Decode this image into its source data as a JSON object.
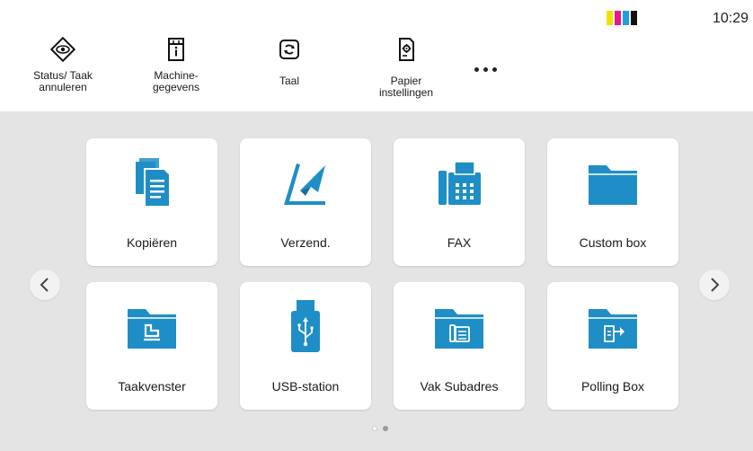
{
  "status_bar": {
    "time": "10:29",
    "toner_colors": [
      "#f2e200",
      "#e8178a",
      "#1ea0dc",
      "#111111"
    ]
  },
  "quick_access": [
    {
      "label_line1": "Status/ Taak",
      "label_line2": "annuleren",
      "icon": "status-eye-icon"
    },
    {
      "label_line1": "Machine-",
      "label_line2": "gegevens",
      "icon": "machine-info-icon"
    },
    {
      "label_line1": "Taal",
      "label_line2": "",
      "icon": "language-icon"
    },
    {
      "label_line1": "Papier",
      "label_line2": "instellingen",
      "icon": "paper-settings-icon"
    }
  ],
  "more_button": {
    "icon": "more-dots-icon"
  },
  "tiles": [
    {
      "label": "Kopiëren",
      "icon": "copy-icon"
    },
    {
      "label": "Verzend.",
      "icon": "send-icon"
    },
    {
      "label": "FAX",
      "icon": "fax-icon"
    },
    {
      "label": "Custom box",
      "icon": "folder-icon"
    },
    {
      "label": "Taakvenster",
      "icon": "job-box-icon"
    },
    {
      "label": "USB-station",
      "icon": "usb-icon"
    },
    {
      "label": "Vak Subadres",
      "icon": "subaddress-box-icon"
    },
    {
      "label": "Polling Box",
      "icon": "polling-box-icon"
    }
  ],
  "navigation": {
    "prev_icon": "chevron-left-icon",
    "next_icon": "chevron-right-icon"
  },
  "pager": {
    "page_count": 2,
    "current_page": 2
  },
  "colors": {
    "accent": "#1f8ec6",
    "background": "#e4e4e4",
    "tile": "#ffffff"
  }
}
